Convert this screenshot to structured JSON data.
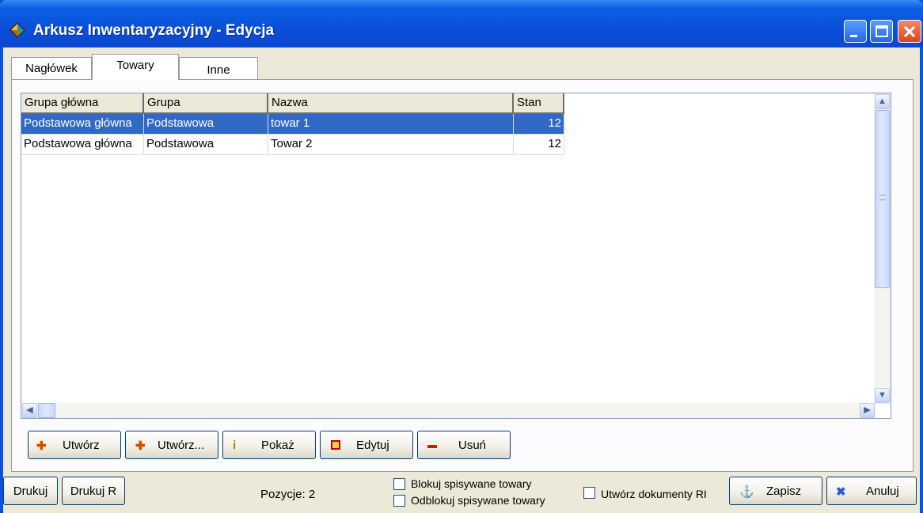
{
  "window": {
    "title": "Arkusz Inwentaryzacyjny - Edycja"
  },
  "tabs": [
    {
      "label": "Nagłówek"
    },
    {
      "label": "Towary"
    },
    {
      "label": "Inne"
    }
  ],
  "grid": {
    "columns": [
      "Grupa główna",
      "Grupa",
      "Nazwa",
      "Stan"
    ],
    "rows": [
      {
        "grupa_glowna": "Podstawowa główna",
        "grupa": "Podstawowa",
        "nazwa": "towar 1",
        "stan": "12",
        "selected": true
      },
      {
        "grupa_glowna": "Podstawowa główna",
        "grupa": "Podstawowa",
        "nazwa": "Towar 2",
        "stan": "12",
        "selected": false
      }
    ]
  },
  "actions": {
    "utworz": "Utwórz",
    "utworz_more": "Utwórz...",
    "pokaz": "Pokaż",
    "edytuj": "Edytuj",
    "usun": "Usuń"
  },
  "footer": {
    "drukuj": "Drukuj",
    "drukuj_r": "Drukuj R",
    "pozycje": "Pozycje: 2",
    "blokuj": "Blokuj spisywane towary",
    "odblokuj": "Odblokuj spisywane towary",
    "utworz_ri": "Utwórz dokumenty RI",
    "zapisz": "Zapisz",
    "anuluj": "Anuluj"
  },
  "colors": {
    "selection": "#316ac5",
    "titlebar": "#0a52d8"
  }
}
